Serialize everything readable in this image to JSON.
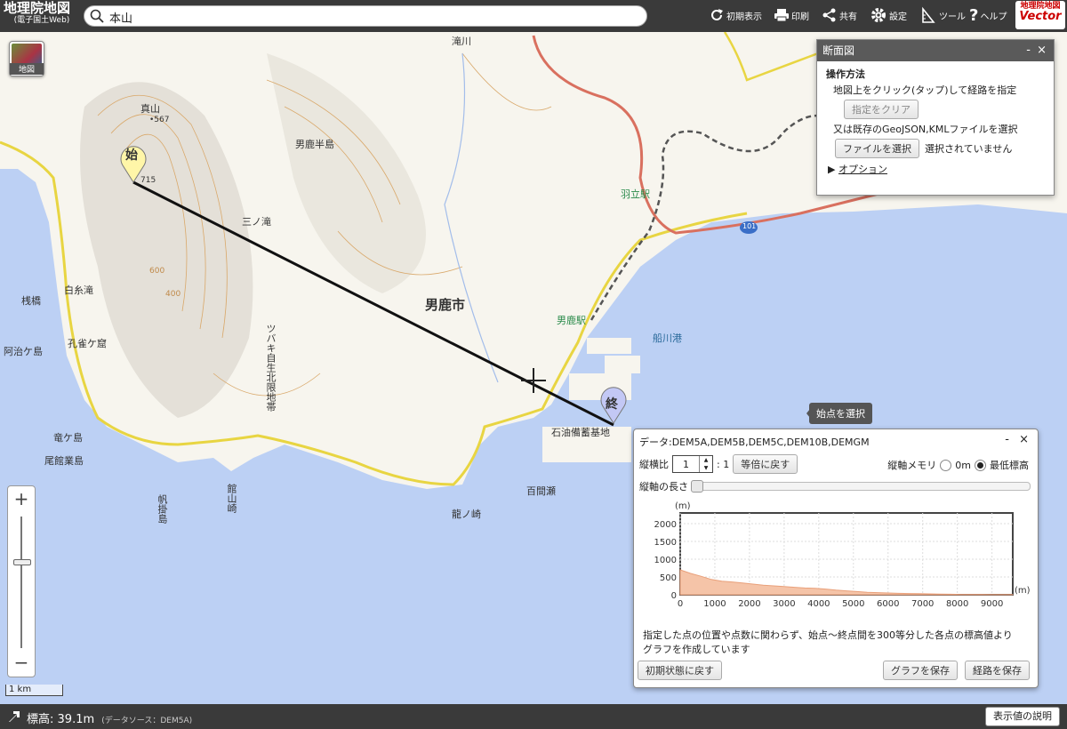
{
  "header": {
    "logo_title": "地理院地図",
    "logo_sub": "(電子国土Web)",
    "search_value": "本山",
    "buttons": {
      "reset": "初期表示",
      "print": "印刷",
      "share": "共有",
      "settings": "設定",
      "tools": "ツール",
      "help": "ヘルプ"
    },
    "vector_logo_top": "地理院地図",
    "vector_logo_bottom": "Vector"
  },
  "map": {
    "layer_button_label": "地図",
    "labels": {
      "shinzan": "真山",
      "shinzan_elev": "•567",
      "honzan_elev": "715",
      "taki_river": "滝川",
      "oga_peninsula": "男鹿半島",
      "sannotaki": "三ノ滝",
      "hanetachi_station": "羽立駅",
      "oga_city": "男鹿市",
      "oga_station": "男鹿駅",
      "funakawa_port": "船川港",
      "shiraitonotaki": "白糸滝",
      "kujakugakubo": "孔雀ケ窟",
      "sanbashi": "桟橋",
      "ajigasawa": "阿治ケ島",
      "tatsugashima": "竜ケ島",
      "oyakejima": "尾館業島",
      "tsubaki": "ツバキ自生北限地帯",
      "oil_base": "石油備蓄基地",
      "hokakejima": "帆掛島",
      "tateyamazaki": "館山崎",
      "hyakumase": "百間瀬",
      "ryunosaki": "龍ノ崎",
      "route_101": "101",
      "contour_600": "600",
      "contour_400": "400"
    },
    "start_marker": "始",
    "end_marker": "終",
    "hint": "始点を選択",
    "scale": "1 km"
  },
  "profile_panel": {
    "title": "断面図",
    "section": "操作方法",
    "instruction": "地図上をクリック(タップ)して経路を指定",
    "clear_button": "指定をクリア",
    "file_instruction": "又は既存のGeoJSON,KMLファイルを選択",
    "file_button": "ファイルを選択",
    "file_status": "選択されていません",
    "options_link": "オプション",
    "minimize": "-",
    "close": "×"
  },
  "chart_panel": {
    "data_sources": "データ:DEM5A,DEM5B,DEM5C,DEM10B,DEMGM",
    "minimize": "-",
    "close": "×",
    "ratio_label": "縦横比",
    "ratio_value": "1",
    "ratio_suffix": ": 1",
    "equal_button": "等倍に戻す",
    "axis_label": "縦軸メモリ",
    "option_0m": "0m",
    "option_min": "最低標高",
    "axis_length_label": "縦軸の長さ",
    "y_unit": "(m)",
    "x_unit": "(m)",
    "note_line1": "指定した点の位置や点数に関わらず、始点～終点間を300等分した各点の標高値より",
    "note_line2": "グラフを作成しています",
    "reset_button": "初期状態に戻す",
    "save_graph_button": "グラフを保存",
    "save_route_button": "経路を保存"
  },
  "chart_data": {
    "type": "area",
    "x": [
      0,
      300,
      600,
      900,
      1200,
      1500,
      1800,
      2100,
      2400,
      2700,
      3000,
      3300,
      3600,
      3900,
      4200,
      4500,
      4800,
      5100,
      5400,
      5700,
      6000,
      6300,
      6600,
      6900,
      7200,
      7500,
      7800,
      8100,
      8400,
      8700,
      9000,
      9300,
      9600
    ],
    "y": [
      700,
      600,
      520,
      430,
      380,
      360,
      330,
      300,
      270,
      250,
      230,
      210,
      190,
      180,
      160,
      130,
      110,
      90,
      70,
      60,
      50,
      40,
      35,
      30,
      25,
      20,
      15,
      10,
      10,
      8,
      6,
      5,
      5
    ],
    "xlim": [
      0,
      9600
    ],
    "ylim": [
      0,
      2300
    ],
    "xticks": [
      0,
      1000,
      2000,
      3000,
      4000,
      5000,
      6000,
      7000,
      8000,
      9000
    ],
    "yticks": [
      0,
      500,
      1000,
      1500,
      2000
    ],
    "grid": true,
    "fill_color": "#f5c4a8",
    "line_color": "#e9a07a"
  },
  "bottom": {
    "elev_label": "標高:",
    "elev_value": "39.1m",
    "elev_source": "(データソース：DEM5A)",
    "explain_button": "表示値の説明"
  }
}
